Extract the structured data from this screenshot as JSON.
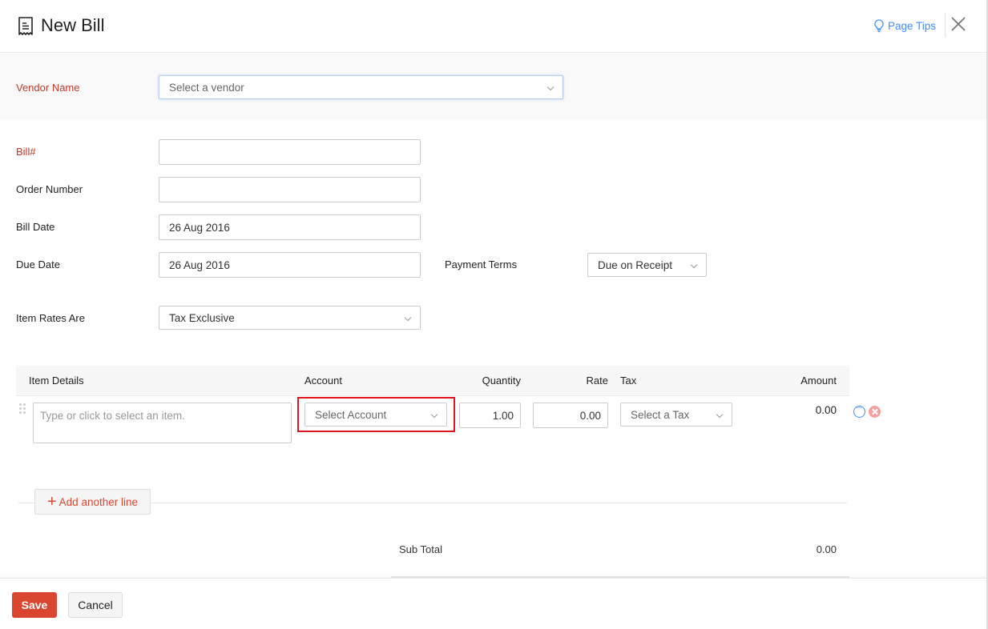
{
  "header": {
    "title": "New Bill",
    "title_icon": "receipt-icon",
    "page_tips": "Page Tips",
    "page_tips_icon": "lightbulb-icon",
    "close_icon": "close-icon"
  },
  "vendor": {
    "label": "Vendor Name",
    "placeholder": "Select a vendor"
  },
  "form": {
    "bill_number": {
      "label": "Bill#",
      "value": ""
    },
    "order_number": {
      "label": "Order Number",
      "value": ""
    },
    "bill_date": {
      "label": "Bill Date",
      "value": "26 Aug 2016"
    },
    "due_date": {
      "label": "Due Date",
      "value": "26 Aug 2016"
    },
    "payment_terms": {
      "label": "Payment Terms",
      "value": "Due on Receipt"
    },
    "item_rates": {
      "label": "Item Rates Are",
      "value": "Tax Exclusive"
    }
  },
  "items_table": {
    "columns": [
      "Item Details",
      "Account",
      "Quantity",
      "Rate",
      "Tax",
      "Amount"
    ],
    "rows": [
      {
        "item_placeholder": "Type or click to select an item.",
        "account_placeholder": "Select Account",
        "quantity": "1.00",
        "rate": "0.00",
        "tax_placeholder": "Select a Tax",
        "amount": "0.00"
      }
    ],
    "add_line": "Add another line"
  },
  "totals": {
    "sub_total_label": "Sub Total",
    "sub_total_value": "0.00"
  },
  "footer": {
    "save": "Save",
    "cancel": "Cancel"
  },
  "colors": {
    "accent": "#d9452e",
    "link": "#408dfb",
    "required_label": "#c0392b",
    "highlight_box": "#e0161c"
  }
}
